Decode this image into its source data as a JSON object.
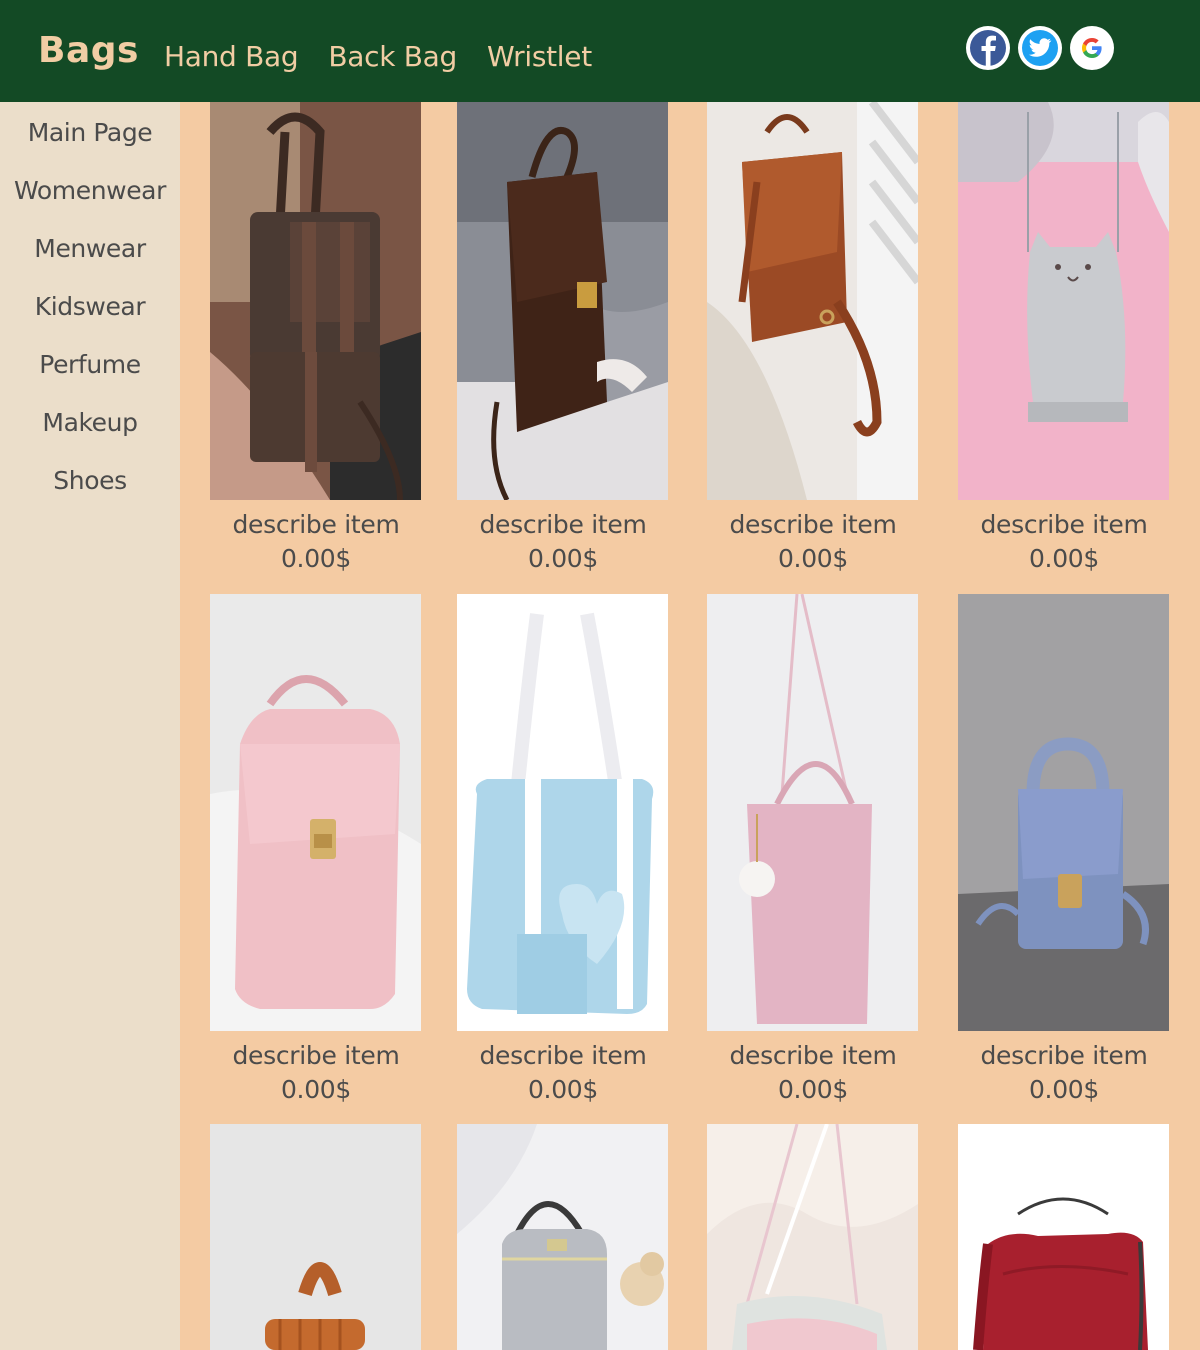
{
  "header": {
    "brand": "Bags",
    "nav": [
      "Hand Bag",
      "Back Bag",
      "Wristlet"
    ],
    "social": [
      {
        "icon": "facebook-icon",
        "color": "#3b5998"
      },
      {
        "icon": "twitter-icon",
        "color": "#1da1f2"
      },
      {
        "icon": "google-icon",
        "color": "#4285f4"
      }
    ]
  },
  "sidebar": {
    "items": [
      "Main Page",
      "Womenwear",
      "Menwear",
      "Kidswear",
      "Perfume",
      "Makeup",
      "Shoes"
    ]
  },
  "products": [
    {
      "description": "describe item",
      "price": "0.00$"
    },
    {
      "description": "describe item",
      "price": "0.00$"
    },
    {
      "description": "describe item",
      "price": "0.00$"
    },
    {
      "description": "describe item",
      "price": "0.00$"
    },
    {
      "description": "describe item",
      "price": "0.00$"
    },
    {
      "description": "describe item",
      "price": "0.00$"
    },
    {
      "description": "describe item",
      "price": "0.00$"
    },
    {
      "description": "describe item",
      "price": "0.00$"
    },
    {
      "description": "",
      "price": ""
    },
    {
      "description": "",
      "price": ""
    },
    {
      "description": "",
      "price": ""
    },
    {
      "description": "",
      "price": ""
    }
  ],
  "colors": {
    "header_bg": "#134a25",
    "brand_text": "#f1cda4",
    "sidebar_bg": "#ebdeca",
    "content_bg": "#f4cba3",
    "text": "#4b4b4b"
  }
}
